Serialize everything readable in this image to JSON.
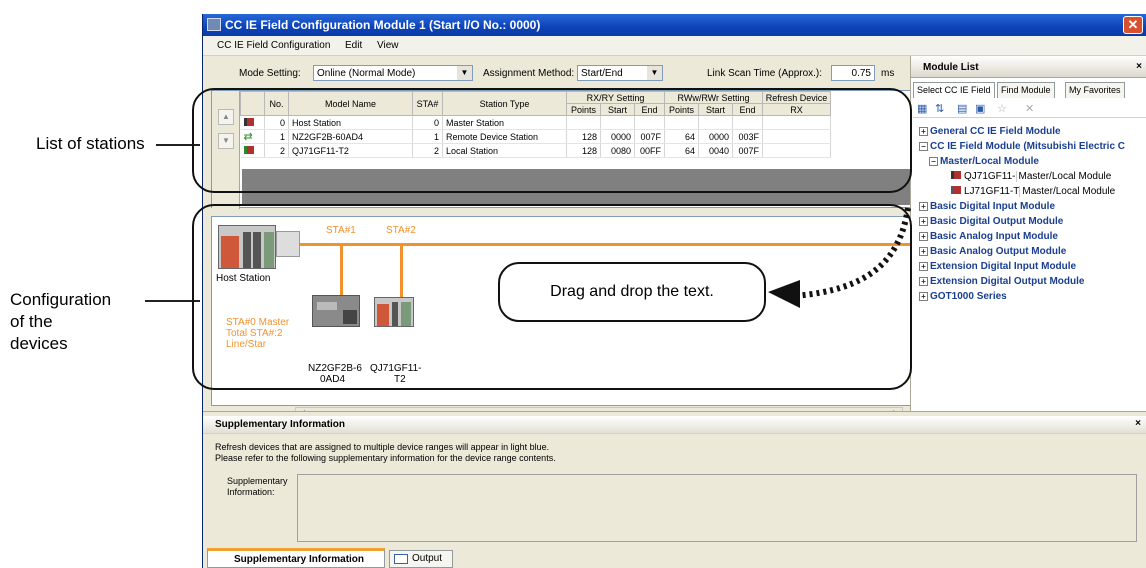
{
  "annotations": {
    "list_of_stations": "List of stations",
    "configuration_line1": "Configuration",
    "configuration_line2": "of the",
    "configuration_line3": "devices",
    "callout_text": "Drag and drop the text."
  },
  "window": {
    "title": "CC IE Field Configuration Module 1 (Start I/O No.: 0000)",
    "close_glyph": "✕"
  },
  "menu": [
    "CC IE Field Configuration",
    "Edit",
    "View"
  ],
  "settings": {
    "mode_label": "Mode Setting:",
    "mode_value": "Online (Normal Mode)",
    "assignment_label": "Assignment Method:",
    "assignment_value": "Start/End",
    "link_scan_label": "Link Scan Time (Approx.):",
    "link_scan_value": "0.75",
    "link_scan_unit": "ms"
  },
  "grid": {
    "headers": {
      "no": "No.",
      "model": "Model Name",
      "sta": "STA#",
      "type": "Station Type",
      "rxry": "RX/RY Setting",
      "rww": "RWw/RWr Setting",
      "refresh": "Refresh Device",
      "points": "Points",
      "start": "Start",
      "end": "End",
      "rx": "RX"
    },
    "rows": [
      {
        "no": "0",
        "model": "Host Station",
        "sta": "0",
        "type": "Master Station",
        "rx_points": "",
        "rx_start": "",
        "rx_end": "",
        "rw_points": "",
        "rw_start": "",
        "rw_end": ""
      },
      {
        "no": "1",
        "model": "NZ2GF2B-60AD4",
        "sta": "1",
        "type": "Remote Device Station",
        "rx_points": "128",
        "rx_start": "0000",
        "rx_end": "007F",
        "rw_points": "64",
        "rw_start": "0000",
        "rw_end": "003F"
      },
      {
        "no": "2",
        "model": "QJ71GF11-T2",
        "sta": "2",
        "type": "Local Station",
        "rx_points": "128",
        "rx_start": "0080",
        "rx_end": "00FF",
        "rw_points": "64",
        "rw_start": "0040",
        "rw_end": "007F"
      }
    ]
  },
  "network": {
    "sta1": "STA#1",
    "sta2": "STA#2",
    "host_label": "Host Station",
    "info_line1": "STA#0  Master",
    "info_line2": "Total STA#:2",
    "info_line3": "Line/Star",
    "dev1_line1": "NZ2GF2B-6",
    "dev1_line2": "0AD4",
    "dev2_line1": "QJ71GF11-",
    "dev2_line2": "T2"
  },
  "module_list": {
    "title": "Module List",
    "tabs": [
      "Select CC IE Field",
      "Find Module",
      "My Favorites"
    ],
    "items": [
      "General CC IE Field Module",
      "CC IE Field Module (Mitsubishi Electric C",
      "Master/Local Module",
      "QJ71GF11-",
      "Master/Local Module",
      "LJ71GF11-T",
      "Master/Local Module",
      "Basic Digital Input Module",
      "Basic Digital Output Module",
      "Basic Analog Input Module",
      "Basic Analog Output Module",
      "Extension Digital Input Module",
      "Extension Digital Output Module",
      "GOT1000 Series"
    ]
  },
  "supplementary": {
    "title": "Supplementary Information",
    "line1": "Refresh devices that are assigned to multiple device ranges will appear in light blue.",
    "line2": "Please refer to the following supplementary information for the device range contents.",
    "field_label1": "Supplementary",
    "field_label2": "Information:",
    "tab_active": "Supplementary Information",
    "tab_output": "Output"
  },
  "colors": {
    "network_line": "#f2922e",
    "title_blue": "#0c44b8",
    "tree_text": "#1a3f8f"
  }
}
